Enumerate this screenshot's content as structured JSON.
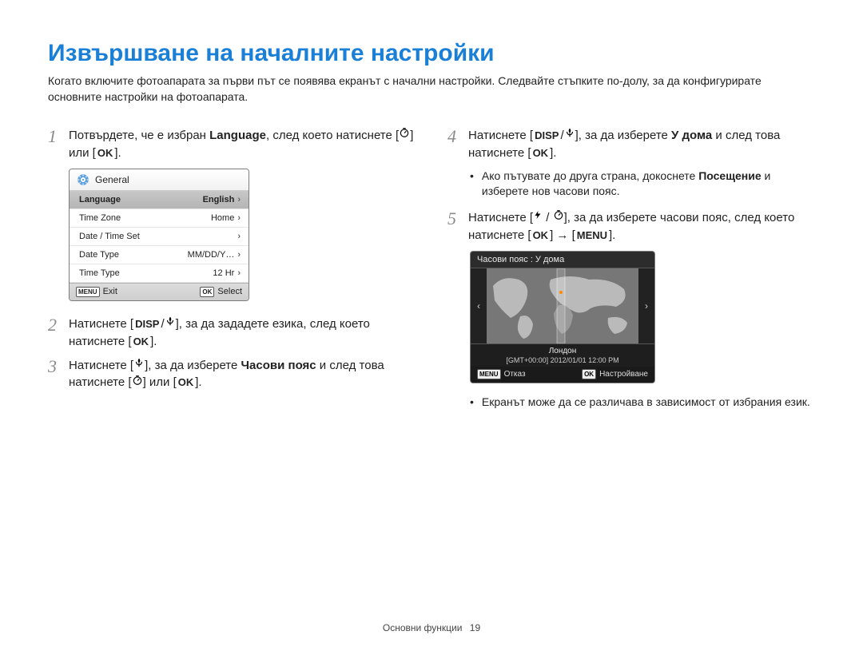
{
  "title": "Извършване на началните настройки",
  "intro": "Когато включите фотоапарата за първи път се появява екранът с начални настройки. Следвайте стъпките по-долу, за да конфигурирате основните настройки на фотоапарата.",
  "steps": {
    "s1_pre": "Потвърдете, че е избран ",
    "s1_bold": "Language",
    "s1_post": ", след което натиснете [",
    "s1_or": "] или [",
    "s1_end": "].",
    "s2_pre": "Натиснете [",
    "s2_mid": "], за да зададете езика, след което натиснете [",
    "s2_end": "].",
    "s3_pre": "Натиснете [",
    "s3_mid": "], за да изберете ",
    "s3_bold": "Часови пояс",
    "s3_post": " и след това натиснете [",
    "s3_or": "] или [",
    "s3_end": "].",
    "s4_pre": "Натиснете [",
    "s4_mid": "], за да изберете ",
    "s4_bold": "У дома",
    "s4_post": " и след това натиснете [",
    "s4_end": "].",
    "s4_bullet": "Ако пътувате до друга страна, докоснете ",
    "s4_bullet_bold": "Посещение",
    "s4_bullet_post": " и изберете нов часови пояс.",
    "s5_pre": "Натиснете [",
    "s5_mid": "], за да изберете часови пояс, след което натиснете [",
    "s5_arrow": "] → [",
    "s5_end": "].",
    "note": "Екранът може да се различава в зависимост от избрания език."
  },
  "keys": {
    "ok": "OK",
    "menu": "MENU",
    "disp": "DISP"
  },
  "menu_ss": {
    "header": "General",
    "items": [
      {
        "label": "Language",
        "value": "English",
        "selected": true
      },
      {
        "label": "Time Zone",
        "value": "Home",
        "selected": false
      },
      {
        "label": "Date / Time Set",
        "value": "",
        "selected": false
      },
      {
        "label": "Date Type",
        "value": "MM/DD/Y…",
        "selected": false
      },
      {
        "label": "Time Type",
        "value": "12 Hr",
        "selected": false
      }
    ],
    "footer_exit_key": "MENU",
    "footer_exit": "Exit",
    "footer_sel_key": "OK",
    "footer_sel": "Select"
  },
  "tz_ss": {
    "header": "Часови пояс : У дома",
    "city": "Лондон",
    "timeline": "[GMT+00:00]  2012/01/01  12:00 PM",
    "foot_cancel_key": "MENU",
    "foot_cancel": "Отказ",
    "foot_set_key": "OK",
    "foot_set": "Настройване"
  },
  "footer": {
    "section": "Основни функции",
    "page": "19"
  }
}
